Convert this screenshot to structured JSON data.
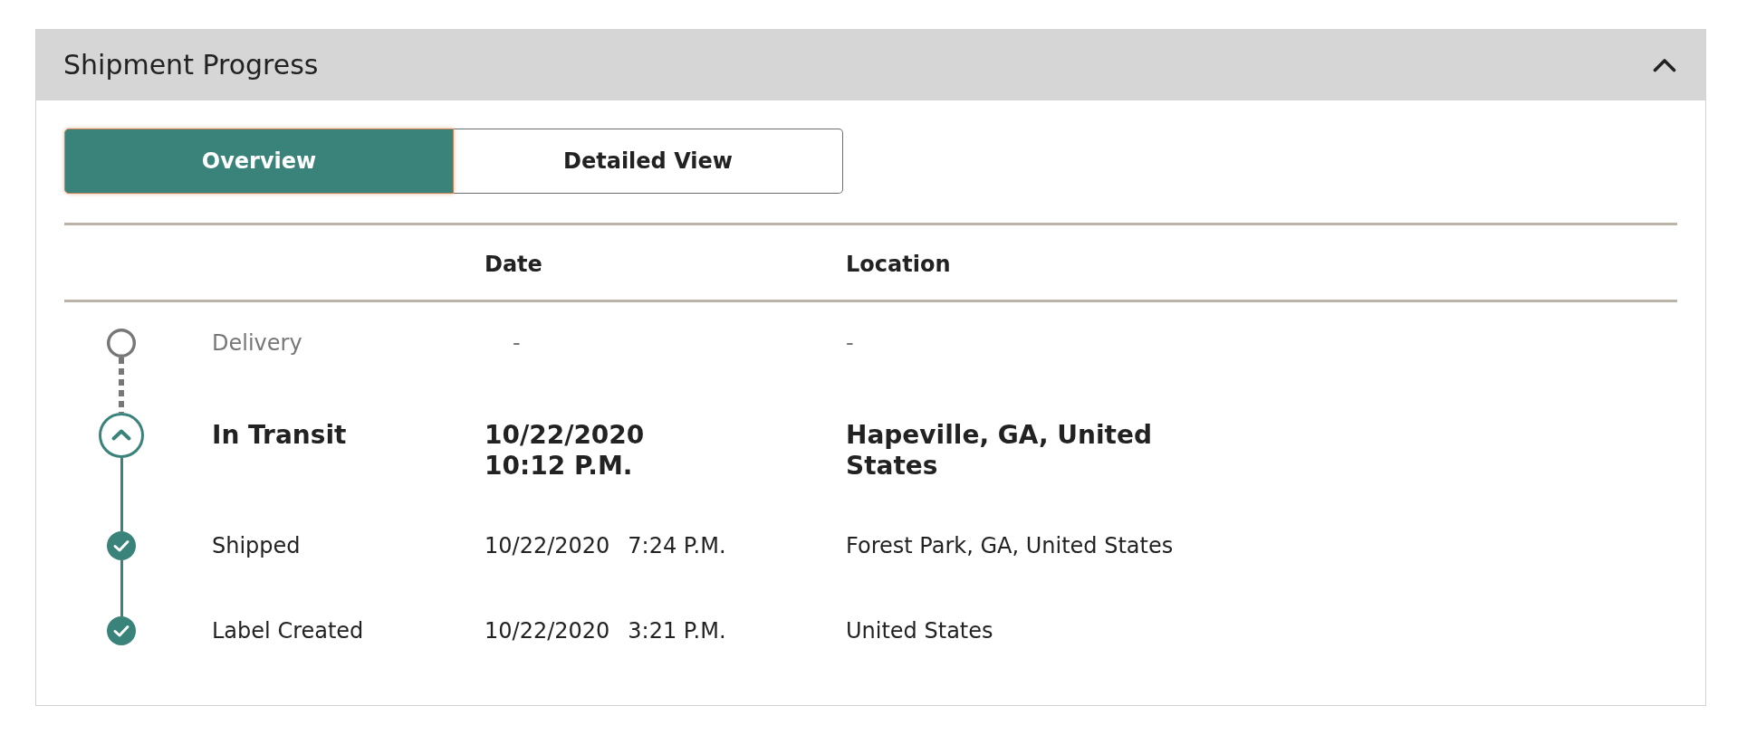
{
  "panel": {
    "title": "Shipment Progress",
    "expanded": true
  },
  "tabs": [
    {
      "label": "Overview",
      "selected": true
    },
    {
      "label": "Detailed View",
      "selected": false
    }
  ],
  "table": {
    "columns": [
      {
        "label": "Date"
      },
      {
        "label": "Location"
      }
    ],
    "rows": [
      {
        "kind": "pending",
        "status": "Delivery",
        "date": "-",
        "location": "-"
      },
      {
        "kind": "current",
        "status": "In Transit",
        "date": "10/22/2020",
        "time": "10:12 P.M.",
        "location": "Hapeville, GA, United States"
      },
      {
        "kind": "done",
        "status": "Shipped",
        "date": "10/22/2020",
        "time": "7:24 P.M.",
        "location": "Forest Park, GA, United States"
      },
      {
        "kind": "done",
        "status": "Label Created",
        "date": "10/22/2020",
        "time": "3:21 P.M.",
        "location": "United States"
      }
    ]
  }
}
